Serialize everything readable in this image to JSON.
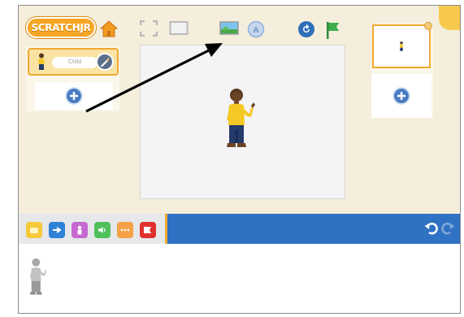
{
  "app": {
    "logo_text": "SCRATCHJR"
  },
  "sprite_tray": {
    "sprite_name": "Child"
  },
  "colors": {
    "background": "#f5eedc",
    "accent_orange": "#f0a830",
    "category_bar": "#2f71c3",
    "flag_green": "#3fae49",
    "add_button": "#4a7cc2"
  },
  "toolbar_icons": [
    "fullscreen-icon",
    "presentation-mode-icon",
    "change-background-icon",
    "add-text-icon",
    "reset-icon",
    "green-flag-icon"
  ],
  "categories": [
    {
      "name": "triggering-blocks",
      "color": "#f6c93a"
    },
    {
      "name": "motion-blocks",
      "color": "#2f82d6"
    },
    {
      "name": "looks-blocks",
      "color": "#c66ad1"
    },
    {
      "name": "sound-blocks",
      "color": "#4fc05a"
    },
    {
      "name": "control-blocks",
      "color": "#f5a047"
    },
    {
      "name": "end-blocks",
      "color": "#e0312f"
    }
  ]
}
